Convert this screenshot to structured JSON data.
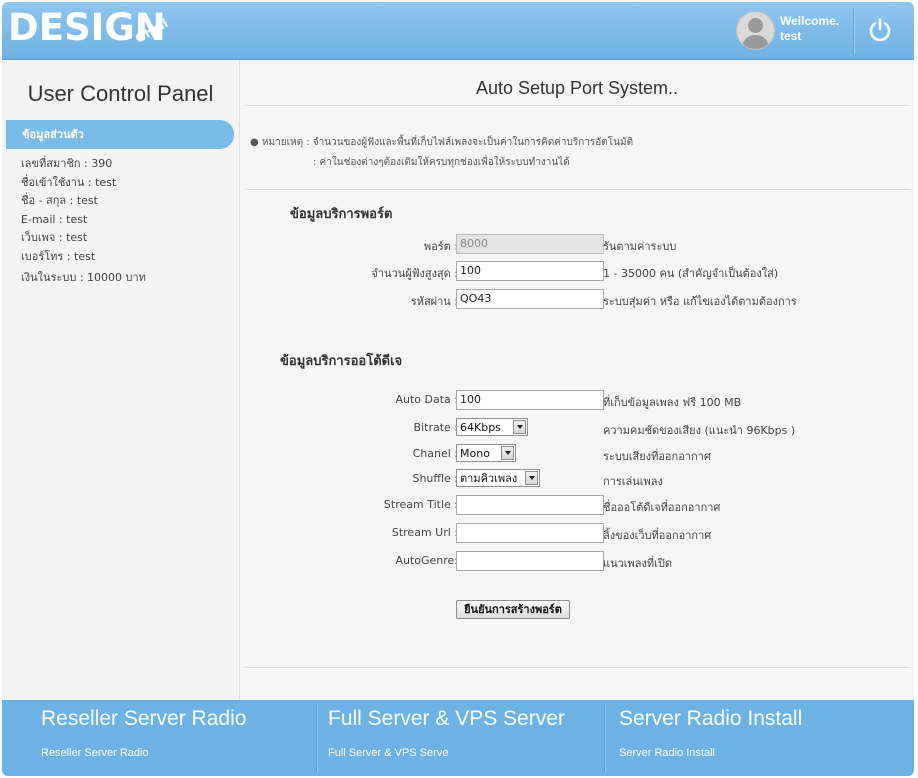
{
  "header": {
    "logo_text": "DESIGN",
    "logo_sub": "Ohmi",
    "welcome_label": "Wellcome.",
    "username": "test",
    "icons": [
      "avatar",
      "power-icon"
    ]
  },
  "sidebar": {
    "title": "User Control Panel",
    "active_tab": "ข้อมูลส่วนตัว",
    "info": [
      "เลขที่สมาชิก : 390",
      "ชื่อเข้าใช้งาน : test",
      "ชื่อ - สกุล : test",
      "E-mail : test",
      "เว็บเพจ : test",
      "เบอร์โทร : test",
      "เงินในระบบ : 10000 บาท"
    ]
  },
  "main": {
    "title": "Auto Setup Port System..",
    "note_line1": "● หมายเหตุ : จำนวนของผู้ฟังและพื้นที่เก็บไฟล์เพลงจะเป็นค่าในการคิดค่าบริการอัตโนมัติ",
    "note_line2": ": ค่าในช่องต่างๆต้องเติมให้ครบทุกช่องเพื่อให้ระบบทำงานได้",
    "section_port": "ข้อมูลบริการพอร์ต",
    "section_autodj": "ข้อมูลบริการออโต้ดีเจ",
    "port_label": "พอร์ต :",
    "port_value": "8000",
    "port_hint": "รันตามค่าระบบ",
    "listeners_label": "จำนวนผู้ฟังสูงสุด :",
    "listeners_value": "100",
    "listeners_hint": "1 - 35000 คน (สำคัญจำเป็นต้องใส่)",
    "password_label": "รหัสผ่าน :",
    "password_value": "QO43",
    "password_hint": "ระบบสุ่มค่า หรือ แก้ไขเองได้ตามต้องการ",
    "autodata_label": "Auto Data :",
    "autodata_value": "100",
    "autodata_hint": "ที่เก็บข้อมูลเพลง ฟรี 100 MB",
    "bitrate_label": "Bitrate :",
    "bitrate_value": "64Kbps",
    "bitrate_hint": "ความคมชัดของเสียง (แนะนำ 96Kbps )",
    "chanel_label": "Chanel :",
    "chanel_value": "Mono",
    "chanel_hint": "ระบบเสียงที่ออกอากาศ",
    "shuffle_label": "Shuffle :",
    "shuffle_value": "ตามคิวเพลง",
    "shuffle_hint": "การเล่นเพลง",
    "stream_title_label": "Stream Title :",
    "stream_title_value": "",
    "stream_title_hint": "ชื่อออโต้ดีเจที่ออกอากาศ",
    "stream_url_label": "Stream Url :",
    "stream_url_value": "",
    "stream_url_hint": "ลิ้งของเว็บที่ออกอากาศ",
    "autogenre_label": "AutoGenre:",
    "autogenre_value": "",
    "autogenre_hint": "แนวเพลงที่เปิด",
    "submit_label": "ยืนยันการสร้างพอร์ต"
  },
  "footer": {
    "columns": [
      {
        "title": "Reseller Server Radio",
        "sub": "Reseller Server Radio"
      },
      {
        "title": "Full Server & VPS Server",
        "sub": "Full Server & VPS Serve"
      },
      {
        "title": "Server Radio Install",
        "sub": "Server Radio Install"
      }
    ]
  },
  "colors": {
    "header_blue": "#7bbbe8",
    "footer_blue": "#6db2e4",
    "panel_bg": "#f4f4f4"
  }
}
